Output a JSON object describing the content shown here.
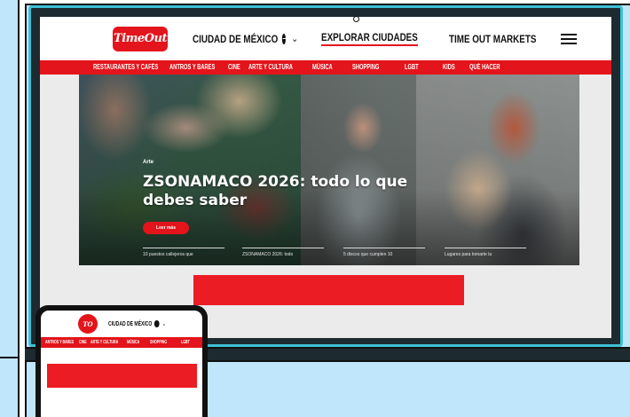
{
  "site": {
    "logo_text": "TimeOut",
    "city": "CIUDAD DE MÉXICO",
    "explore": "EXPLORAR CIUDADES",
    "markets": "TIME OUT MARKETS"
  },
  "categories": [
    "RESTAURANTES Y CAFÉS",
    "ANTROS Y BARES",
    "CINE",
    "ARTE Y CULTURA",
    "MÚSICA",
    "SHOPPING",
    "LGBT",
    "KIDS",
    "QUÉ HACER"
  ],
  "hero": {
    "kicker": "Arte",
    "title": "ZSONAMACO 2026: todo lo que debes saber",
    "button": "Leer más",
    "stories": [
      "10 puestos callejeros que",
      "ZSONAMACO 2026: todo",
      "5 discos que cumplen 10",
      "Lugares para tomarte la"
    ]
  },
  "phone": {
    "logo_text": "TO",
    "city": "CIUDAD DE MÉXICO",
    "categories": [
      "ANTROS Y BARES",
      "CINE",
      "ARTE Y CULTURA",
      "MÚSICA",
      "SHOPPING",
      "LGBT"
    ]
  },
  "colors": {
    "brand_red": "#e3141b",
    "panel_blue": "#bfe6fb",
    "laptop_frame": "#3ec0d6"
  }
}
